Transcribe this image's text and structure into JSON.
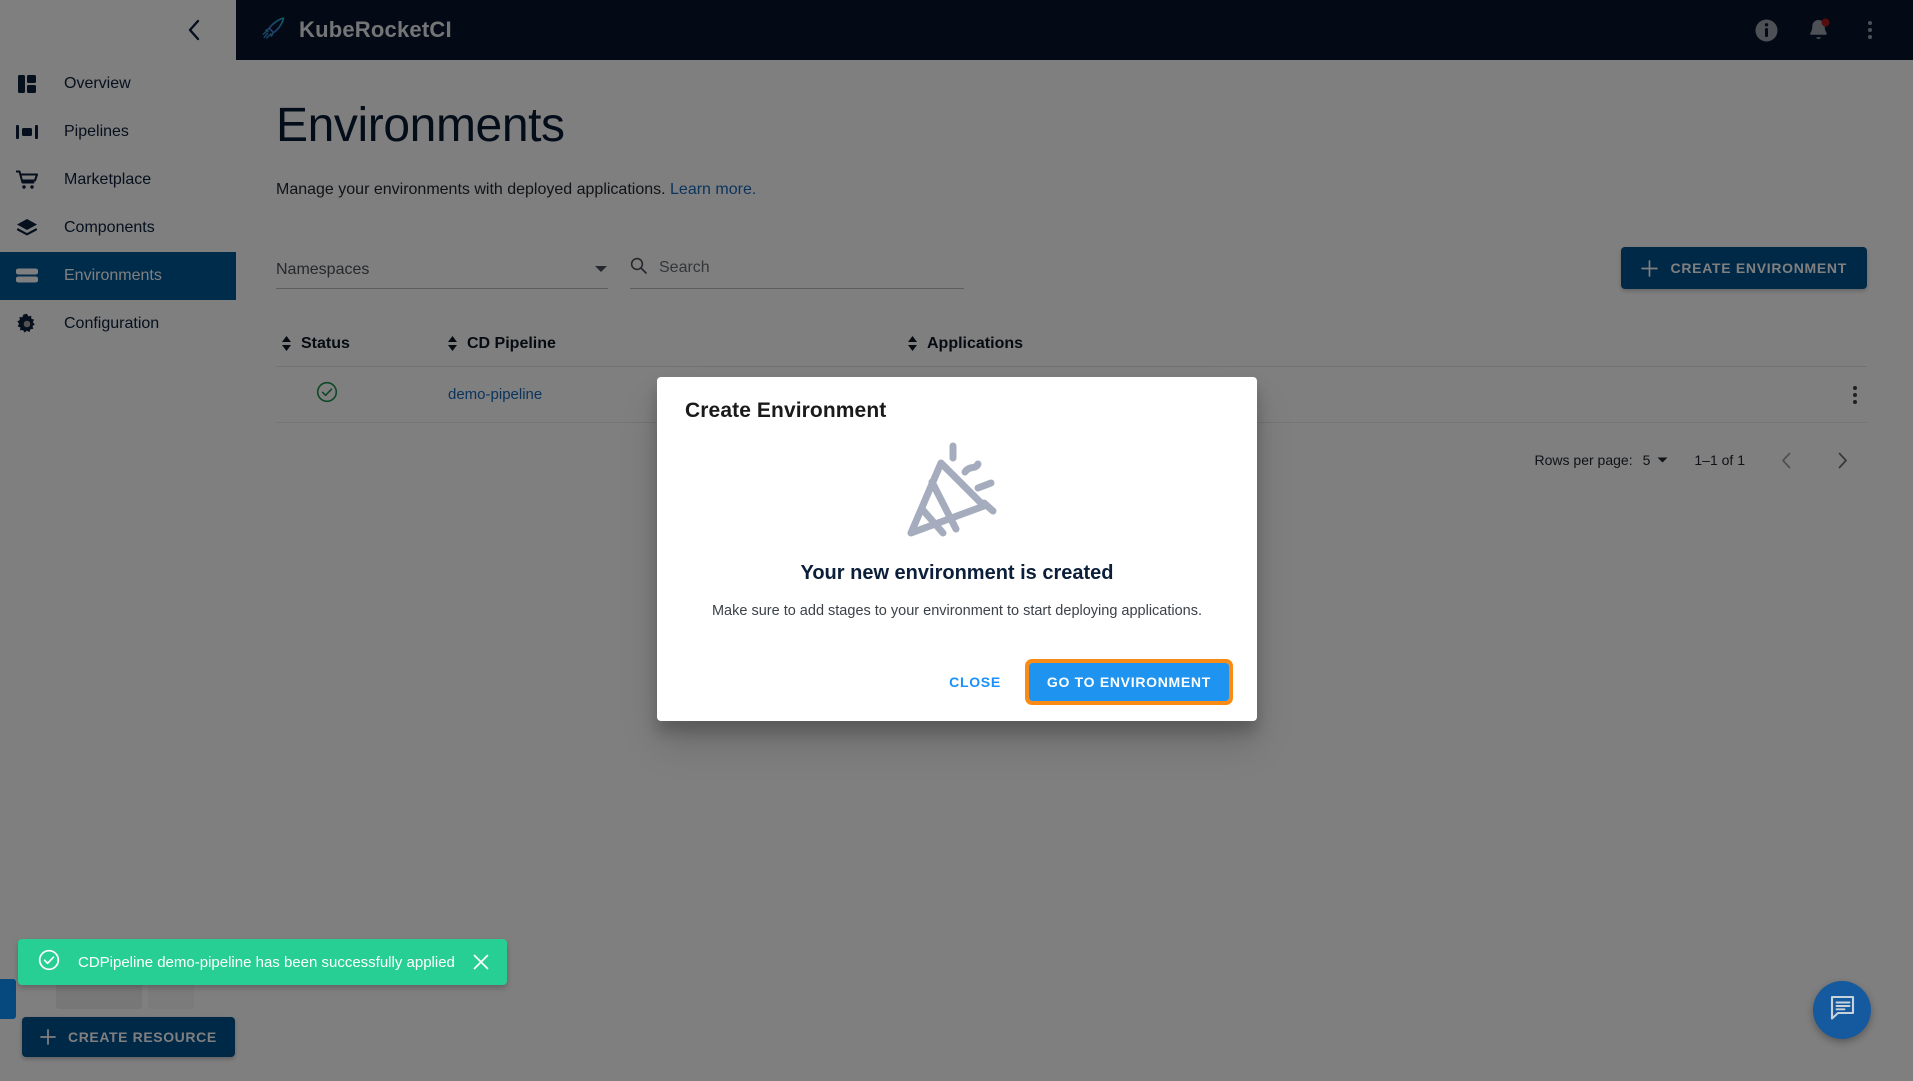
{
  "header": {
    "brand": "KubeRocketCI",
    "icons": {
      "info": "info-icon",
      "notifications": "bell-icon",
      "more": "kebab-menu-icon"
    }
  },
  "sidebar": {
    "collapse_label": "‹",
    "items": [
      {
        "label": "Overview",
        "icon": "dashboard-icon",
        "active": false
      },
      {
        "label": "Pipelines",
        "icon": "pipelines-icon",
        "active": false
      },
      {
        "label": "Marketplace",
        "icon": "cart-icon",
        "active": false
      },
      {
        "label": "Components",
        "icon": "layers-icon",
        "active": false
      },
      {
        "label": "Environments",
        "icon": "environments-icon",
        "active": true
      },
      {
        "label": "Configuration",
        "icon": "gear-icon",
        "active": false
      }
    ],
    "create_resource_label": "CREATE RESOURCE"
  },
  "main": {
    "title": "Environments",
    "subtitle": "Manage your environments with deployed applications.",
    "learn_more": "Learn more.",
    "namespaces_placeholder": "Namespaces",
    "search_placeholder": "Search",
    "search_value": "",
    "create_environment_label": "CREATE ENVIRONMENT"
  },
  "table": {
    "columns": [
      "Status",
      "CD Pipeline",
      "Applications"
    ],
    "rows": [
      {
        "status": "healthy",
        "cd_pipeline": "demo-pipeline",
        "applications": ""
      }
    ]
  },
  "pagination": {
    "rows_per_page_label": "Rows per page:",
    "rows_per_page_value": "5",
    "range": "1–1 of 1"
  },
  "dialog": {
    "title": "Create Environment",
    "icon": "party-popper-icon",
    "heading": "Your new environment is created",
    "text": "Make sure to add stages to your environment to start deploying applications.",
    "close_label": "CLOSE",
    "primary_label": "GO TO ENVIRONMENT"
  },
  "toast": {
    "message": "CDPipeline demo-pipeline has been successfully applied",
    "icon": "check-circle-icon",
    "close_icon": "close-icon"
  },
  "chat": {
    "icon": "chat-bubble-icon"
  },
  "colors": {
    "sidebar_active": "#005999",
    "brand_bar": "#06152b",
    "primary_button": "#00518f",
    "dialog_primary": "#1e93f0",
    "focus_ring": "#fa8c16",
    "toast": "#27cf95",
    "link": "#1669bb",
    "status_ok": "#1e8e4e"
  }
}
